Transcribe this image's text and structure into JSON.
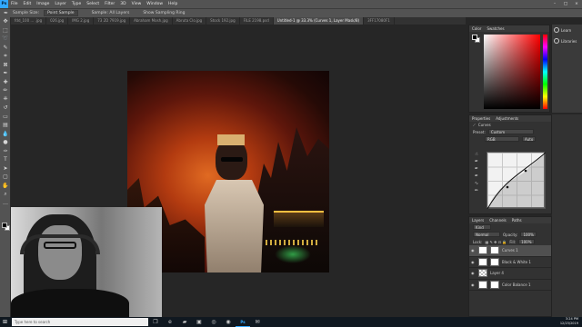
{
  "app": {
    "logo": "Ps",
    "menu": [
      "File",
      "Edit",
      "Image",
      "Layer",
      "Type",
      "Select",
      "Filter",
      "3D",
      "View",
      "Window",
      "Help"
    ]
  },
  "options_bar": {
    "sample_size": "Sample Size:",
    "sample_mode": "Point Sample",
    "sample_layers": "Sample: All Layers",
    "show_ring": "Show Sampling Ring"
  },
  "document_tabs": [
    {
      "label": "fdd_100 … .jpg",
      "active": false
    },
    {
      "label": "026.jpg",
      "active": false
    },
    {
      "label": "IMG 2.jpg",
      "active": false
    },
    {
      "label": "73 2D 7919.jpg",
      "active": false
    },
    {
      "label": "Abraham Mosh.jpg",
      "active": false
    },
    {
      "label": "Abruta Clo.jpg",
      "active": false
    },
    {
      "label": "Stock 192.jpg",
      "active": false
    },
    {
      "label": "FILE 2198.psd",
      "active": false
    },
    {
      "label": "Untitled-1 @ 33.3% (Curves 1, Layer Mask/8)",
      "active": true
    },
    {
      "label": "3FF17080F1",
      "active": false
    }
  ],
  "color_panel": {
    "tabs": [
      "Color",
      "Swatches"
    ],
    "foreground": "#000000",
    "background": "#ffffff"
  },
  "learn_panel": {
    "items": [
      "Learn",
      "Libraries"
    ]
  },
  "properties_panel": {
    "tabs": [
      "Properties",
      "Adjustments"
    ],
    "title": "Curves",
    "preset_label": "Preset:",
    "preset_value": "Custom",
    "channel_value": "RGB",
    "auto_label": "Auto"
  },
  "layers_panel": {
    "tabs": [
      "Layers",
      "Channels",
      "Paths"
    ],
    "kind_label": "Kind",
    "blend_mode": "Normal",
    "opacity_label": "Opacity:",
    "opacity_value": "100%",
    "lock_label": "Lock:",
    "fill_label": "Fill:",
    "fill_value": "100%",
    "layers": [
      {
        "name": "Curves 1",
        "selected": true,
        "thumb": "white"
      },
      {
        "name": "Black & White 1",
        "selected": false,
        "thumb": "white"
      },
      {
        "name": "Layer 4",
        "selected": false,
        "thumb": "checker"
      },
      {
        "name": "Color Balance 1",
        "selected": false,
        "thumb": "white"
      }
    ]
  },
  "taskbar": {
    "search_placeholder": "Type here to search",
    "time": "3:24 PM",
    "date": "12/23/2019"
  }
}
